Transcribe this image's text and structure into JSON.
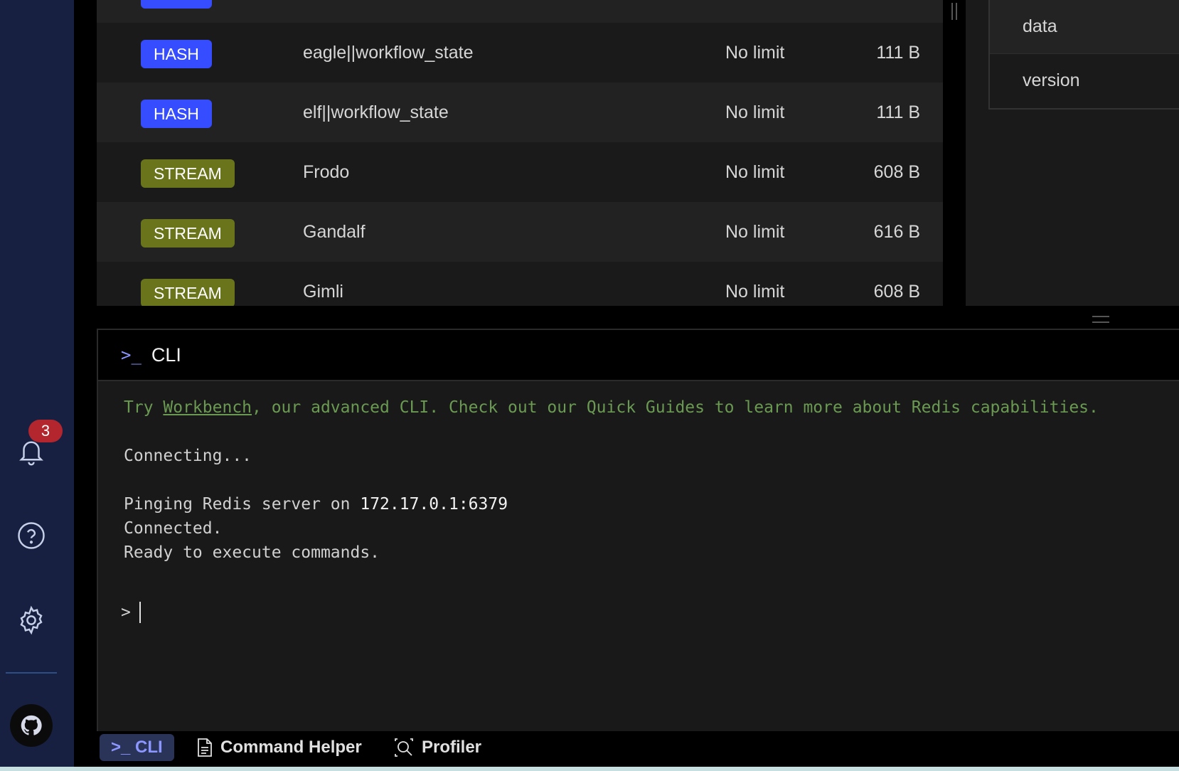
{
  "sidebar": {
    "notifications_count": "3",
    "icons": [
      "bell-icon",
      "help-icon",
      "gear-icon",
      "github-icon"
    ]
  },
  "keys": [
    {
      "type": "HASH",
      "name": "",
      "ttl": "",
      "size": ""
    },
    {
      "type": "HASH",
      "name": "eagle||workflow_state",
      "ttl": "No limit",
      "size": "111 B"
    },
    {
      "type": "HASH",
      "name": "elf||workflow_state",
      "ttl": "No limit",
      "size": "111 B"
    },
    {
      "type": "STREAM",
      "name": "Frodo",
      "ttl": "No limit",
      "size": "608 B"
    },
    {
      "type": "STREAM",
      "name": "Gandalf",
      "ttl": "No limit",
      "size": "616 B"
    },
    {
      "type": "STREAM",
      "name": "Gimli",
      "ttl": "No limit",
      "size": "608 B"
    }
  ],
  "type_colors": {
    "HASH": "#364cff",
    "STREAM": "#6a741b"
  },
  "details": {
    "items": [
      "data",
      "version"
    ]
  },
  "cli": {
    "header_icon": ">_",
    "title": "CLI",
    "tip_prefix": "Try ",
    "tip_link": "Workbench",
    "tip_suffix": ", our advanced CLI. Check out our Quick Guides to learn more about Redis capabilities.",
    "line_connecting": "Connecting...",
    "line_ping_prefix": "Pinging Redis server on ",
    "line_ping_address": "172.17.0.1:6379",
    "line_connected": "Connected.",
    "line_ready": "Ready to execute commands.",
    "prompt": ">"
  },
  "bottom_tabs": {
    "cli": ">_ CLI",
    "command_helper": "Command Helper",
    "profiler": "Profiler"
  }
}
